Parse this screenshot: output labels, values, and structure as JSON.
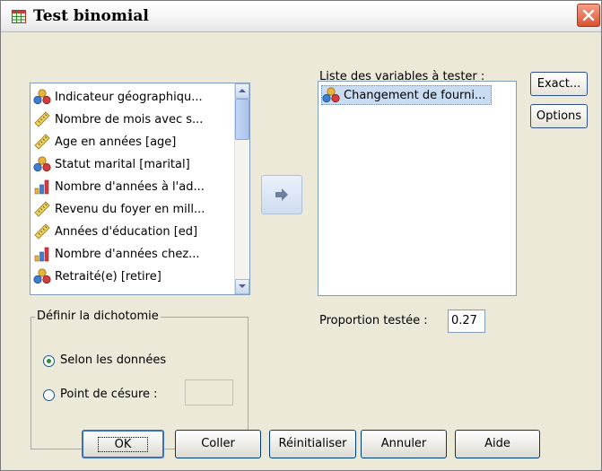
{
  "window": {
    "title": "Test binomial",
    "app_icon": "dataset-grid-icon",
    "close_icon": "close-icon"
  },
  "source_list": {
    "items": [
      {
        "label": "Indicateur géographiqu...",
        "icon": "nominal-icon"
      },
      {
        "label": "Nombre de mois avec s...",
        "icon": "scale-icon"
      },
      {
        "label": "Age en années [age]",
        "icon": "scale-icon"
      },
      {
        "label": "Statut marital [marital]",
        "icon": "nominal-icon"
      },
      {
        "label": "Nombre d'années à l'ad...",
        "icon": "ordinal-icon"
      },
      {
        "label": "Revenu du foyer en mill...",
        "icon": "scale-icon"
      },
      {
        "label": "Années d'éducation [ed]",
        "icon": "scale-icon"
      },
      {
        "label": "Nombre d'années chez...",
        "icon": "ordinal-icon"
      },
      {
        "label": "Retraité(e) [retire]",
        "icon": "nominal-icon"
      }
    ]
  },
  "test_list": {
    "title": "Liste des variables à tester :",
    "items": [
      {
        "label": "Changement de fourni...",
        "icon": "nominal-icon"
      }
    ]
  },
  "buttons": {
    "exact": "Exact...",
    "options": "Options",
    "ok": "OK",
    "paste": "Coller",
    "reset": "Réinitialiser",
    "cancel": "Annuler",
    "help": "Aide"
  },
  "proportion": {
    "label": "Proportion testée :",
    "value": "0.27"
  },
  "dichotomy": {
    "title": "Définir la dichotomie",
    "option_data": "Selon les données",
    "option_cut": "Point de césure :",
    "selected": "option_data",
    "cut_value": ""
  },
  "colors": {
    "accent": "#3c6ec4",
    "selection": "#c9dcf1",
    "dialog_bg": "#ece9d8"
  }
}
